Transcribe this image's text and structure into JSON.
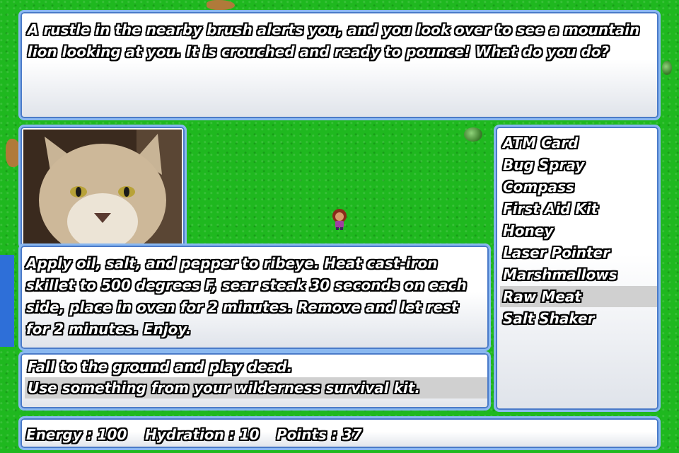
{
  "message": {
    "text": "A rustle in the nearby brush alerts you, and you look over to see a mountain lion looking at you. It is crouched and ready to pounce! What do you do?"
  },
  "portrait": {
    "subject": "mountain-lion"
  },
  "description": {
    "text": "Apply oil, salt, and pepper to ribeye. Heat cast-iron skillet to 500 degrees F, sear steak 30 seconds on each side, place in oven for 2 minutes. Remove and let rest for 2 minutes. Enjoy."
  },
  "choices": [
    {
      "label": "Fall to the ground and play dead.",
      "selected": false
    },
    {
      "label": "Use something from your wilderness survival kit.",
      "selected": true
    }
  ],
  "inventory": [
    {
      "label": "ATM Card",
      "selected": false
    },
    {
      "label": "Bug Spray",
      "selected": false
    },
    {
      "label": "Compass",
      "selected": false
    },
    {
      "label": "First Aid Kit",
      "selected": false
    },
    {
      "label": "Honey",
      "selected": false
    },
    {
      "label": "Laser Pointer",
      "selected": false
    },
    {
      "label": "Marshmallows",
      "selected": false
    },
    {
      "label": "Raw Meat",
      "selected": true
    },
    {
      "label": "Salt Shaker",
      "selected": false
    }
  ],
  "status": {
    "energy": "Energy : 100",
    "hydration": "Hydration : 10",
    "points": "Points : 37"
  },
  "colors": {
    "grass": "#1fb81f",
    "window_border": "#8ab8f0",
    "selection": "#d0d0d0"
  }
}
